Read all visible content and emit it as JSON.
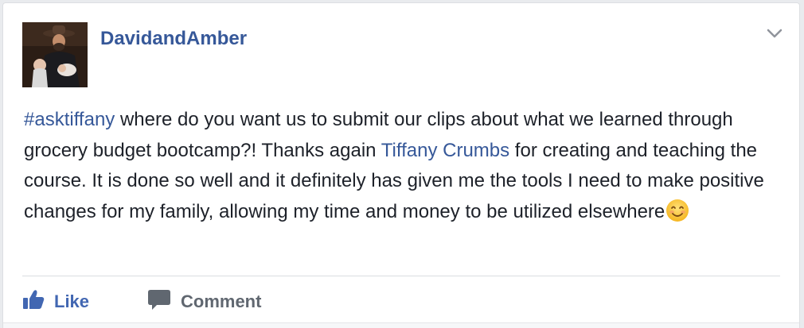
{
  "post": {
    "author": "DavidandAmber",
    "text": {
      "hashtag": "#asktiffany",
      "part1": " where do you want us to submit our clips about what we learned through grocery budget bootcamp?! Thanks again ",
      "mention": "Tiffany Crumbs",
      "part2": " for creating and teaching the course. It is done so well and it definitely has given me the tools I need to make positive changes for my family, allowing my time and money to be utilized elsewhere"
    },
    "emoji": "smiling-face-emoji"
  },
  "actions": {
    "like_label": "Like",
    "comment_label": "Comment"
  },
  "icons": {
    "menu": "chevron-down-icon",
    "like": "thumbs-up-icon",
    "comment": "speech-bubble-icon"
  },
  "colors": {
    "link": "#365899",
    "like_active": "#4267b2",
    "text": "#1d2129",
    "muted": "#606770",
    "background": "#e9ebee"
  }
}
